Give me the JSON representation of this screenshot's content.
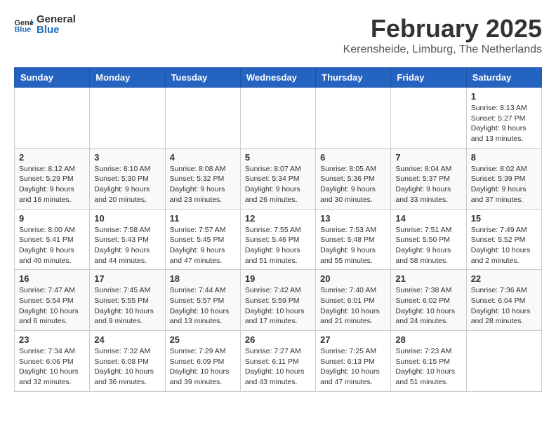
{
  "logo": {
    "general": "General",
    "blue": "Blue"
  },
  "header": {
    "month": "February 2025",
    "location": "Kerensheide, Limburg, The Netherlands"
  },
  "weekdays": [
    "Sunday",
    "Monday",
    "Tuesday",
    "Wednesday",
    "Thursday",
    "Friday",
    "Saturday"
  ],
  "weeks": [
    [
      {
        "day": "",
        "info": ""
      },
      {
        "day": "",
        "info": ""
      },
      {
        "day": "",
        "info": ""
      },
      {
        "day": "",
        "info": ""
      },
      {
        "day": "",
        "info": ""
      },
      {
        "day": "",
        "info": ""
      },
      {
        "day": "1",
        "info": "Sunrise: 8:13 AM\nSunset: 5:27 PM\nDaylight: 9 hours and 13 minutes."
      }
    ],
    [
      {
        "day": "2",
        "info": "Sunrise: 8:12 AM\nSunset: 5:29 PM\nDaylight: 9 hours and 16 minutes."
      },
      {
        "day": "3",
        "info": "Sunrise: 8:10 AM\nSunset: 5:30 PM\nDaylight: 9 hours and 20 minutes."
      },
      {
        "day": "4",
        "info": "Sunrise: 8:08 AM\nSunset: 5:32 PM\nDaylight: 9 hours and 23 minutes."
      },
      {
        "day": "5",
        "info": "Sunrise: 8:07 AM\nSunset: 5:34 PM\nDaylight: 9 hours and 26 minutes."
      },
      {
        "day": "6",
        "info": "Sunrise: 8:05 AM\nSunset: 5:36 PM\nDaylight: 9 hours and 30 minutes."
      },
      {
        "day": "7",
        "info": "Sunrise: 8:04 AM\nSunset: 5:37 PM\nDaylight: 9 hours and 33 minutes."
      },
      {
        "day": "8",
        "info": "Sunrise: 8:02 AM\nSunset: 5:39 PM\nDaylight: 9 hours and 37 minutes."
      }
    ],
    [
      {
        "day": "9",
        "info": "Sunrise: 8:00 AM\nSunset: 5:41 PM\nDaylight: 9 hours and 40 minutes."
      },
      {
        "day": "10",
        "info": "Sunrise: 7:58 AM\nSunset: 5:43 PM\nDaylight: 9 hours and 44 minutes."
      },
      {
        "day": "11",
        "info": "Sunrise: 7:57 AM\nSunset: 5:45 PM\nDaylight: 9 hours and 47 minutes."
      },
      {
        "day": "12",
        "info": "Sunrise: 7:55 AM\nSunset: 5:46 PM\nDaylight: 9 hours and 51 minutes."
      },
      {
        "day": "13",
        "info": "Sunrise: 7:53 AM\nSunset: 5:48 PM\nDaylight: 9 hours and 55 minutes."
      },
      {
        "day": "14",
        "info": "Sunrise: 7:51 AM\nSunset: 5:50 PM\nDaylight: 9 hours and 58 minutes."
      },
      {
        "day": "15",
        "info": "Sunrise: 7:49 AM\nSunset: 5:52 PM\nDaylight: 10 hours and 2 minutes."
      }
    ],
    [
      {
        "day": "16",
        "info": "Sunrise: 7:47 AM\nSunset: 5:54 PM\nDaylight: 10 hours and 6 minutes."
      },
      {
        "day": "17",
        "info": "Sunrise: 7:45 AM\nSunset: 5:55 PM\nDaylight: 10 hours and 9 minutes."
      },
      {
        "day": "18",
        "info": "Sunrise: 7:44 AM\nSunset: 5:57 PM\nDaylight: 10 hours and 13 minutes."
      },
      {
        "day": "19",
        "info": "Sunrise: 7:42 AM\nSunset: 5:59 PM\nDaylight: 10 hours and 17 minutes."
      },
      {
        "day": "20",
        "info": "Sunrise: 7:40 AM\nSunset: 6:01 PM\nDaylight: 10 hours and 21 minutes."
      },
      {
        "day": "21",
        "info": "Sunrise: 7:38 AM\nSunset: 6:02 PM\nDaylight: 10 hours and 24 minutes."
      },
      {
        "day": "22",
        "info": "Sunrise: 7:36 AM\nSunset: 6:04 PM\nDaylight: 10 hours and 28 minutes."
      }
    ],
    [
      {
        "day": "23",
        "info": "Sunrise: 7:34 AM\nSunset: 6:06 PM\nDaylight: 10 hours and 32 minutes."
      },
      {
        "day": "24",
        "info": "Sunrise: 7:32 AM\nSunset: 6:08 PM\nDaylight: 10 hours and 36 minutes."
      },
      {
        "day": "25",
        "info": "Sunrise: 7:29 AM\nSunset: 6:09 PM\nDaylight: 10 hours and 39 minutes."
      },
      {
        "day": "26",
        "info": "Sunrise: 7:27 AM\nSunset: 6:11 PM\nDaylight: 10 hours and 43 minutes."
      },
      {
        "day": "27",
        "info": "Sunrise: 7:25 AM\nSunset: 6:13 PM\nDaylight: 10 hours and 47 minutes."
      },
      {
        "day": "28",
        "info": "Sunrise: 7:23 AM\nSunset: 6:15 PM\nDaylight: 10 hours and 51 minutes."
      },
      {
        "day": "",
        "info": ""
      }
    ]
  ]
}
